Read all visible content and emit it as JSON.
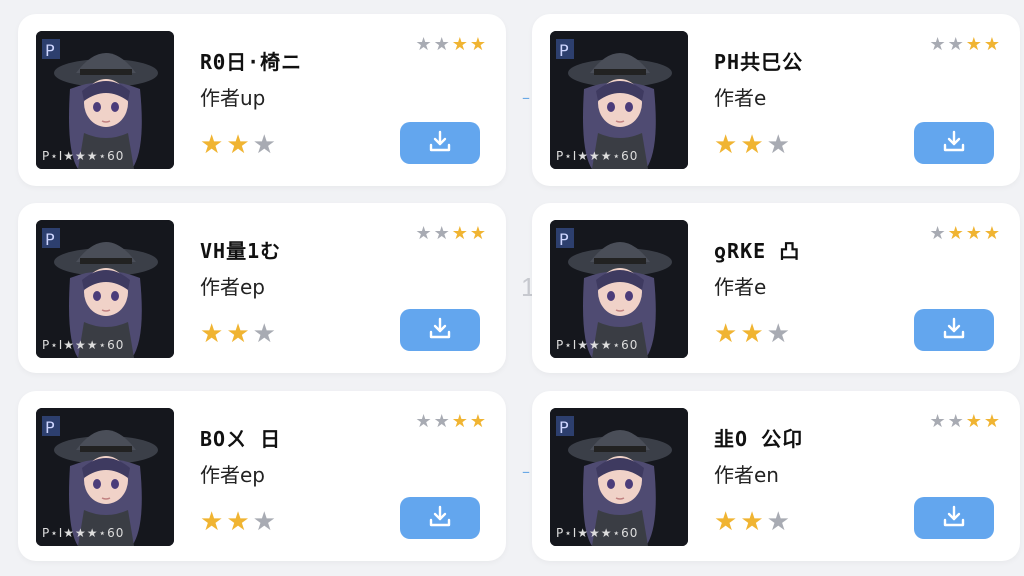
{
  "colors": {
    "background": "#f1f2f5",
    "card": "#ffffff",
    "accent": "#63a6ee",
    "star_on": "#f0b432",
    "star_off": "#a8abb3"
  },
  "background_mark": "1",
  "cards": [
    {
      "title": "RΘ日·椅ニ",
      "author": "作者up",
      "top_rating": 2,
      "main_rating": 2,
      "thumb_caption": "P⋆I★★★⋆60",
      "icon": "download-icon"
    },
    {
      "title": "PH共巳公",
      "author": "作者e",
      "top_rating": 2,
      "main_rating": 2,
      "thumb_caption": "P⋆I★★★⋆60",
      "icon": "download-icon"
    },
    {
      "title": "VH量1む",
      "author": "作者ep",
      "top_rating": 2,
      "main_rating": 2,
      "thumb_caption": "P⋆I★★★⋆60",
      "icon": "download-icon"
    },
    {
      "title": "ƍRKE 凸",
      "author": "作者e",
      "top_rating": 3,
      "main_rating": 2,
      "thumb_caption": "P⋆I★★★⋆60",
      "icon": "download-icon"
    },
    {
      "title": "BOㄨ 日",
      "author": "作者ep",
      "top_rating": 2,
      "main_rating": 2,
      "thumb_caption": "P⋆I★★★⋆60",
      "icon": "download-icon"
    },
    {
      "title": "韭O 公卬",
      "author": "作者en",
      "top_rating": 2,
      "main_rating": 2,
      "thumb_caption": "P⋆I★★★⋆60",
      "icon": "download-icon"
    }
  ]
}
